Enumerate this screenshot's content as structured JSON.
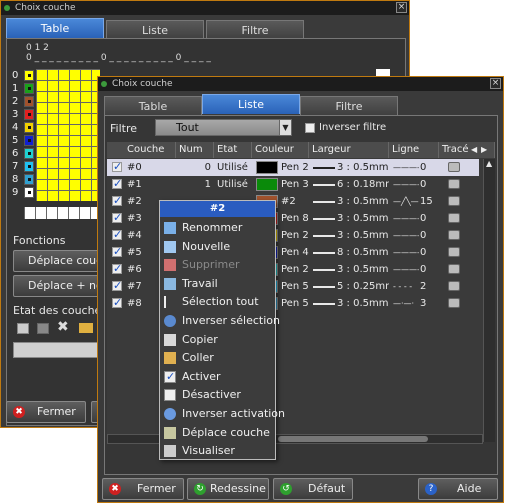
{
  "back_window": {
    "title": "Choix couche",
    "tabs": [
      "Table",
      "Liste",
      "Filtre"
    ],
    "active_tab": "Table",
    "ruler_top": "0                           1                           2",
    "ruler_bottom": "0 _ _ _ _ _ _ _ _ _ 0 _ _ _ _ _ _ _ _ _ 0 _ _ _ _",
    "row_numbers": [
      "0",
      "1",
      "2",
      "3",
      "4",
      "5",
      "6",
      "7",
      "8",
      "9"
    ],
    "row_colors": [
      "#ffff00",
      "#1aa01a",
      "#a0522d",
      "#e02020",
      "#f0d000",
      "#1020d0",
      "#20d0d0",
      "#20c0f0",
      "#30a0d0",
      "#ffffff"
    ],
    "functions_label": "Fonctions",
    "move_button": "Déplace couch",
    "move_new_button": "Déplace + nou",
    "layer_state_label": "Etat des couches",
    "close_button": "Fermer"
  },
  "front_window": {
    "title": "Choix couche",
    "tabs": [
      "Table",
      "Liste",
      "Filtre"
    ],
    "active_tab": "Liste",
    "filter_label": "Filtre",
    "filter_value": "Tout",
    "invert_filter_label": "Inverser filtre",
    "columns": [
      "Couche",
      "Num",
      "Etat",
      "Couleur",
      "Largeur",
      "Ligne",
      "Tracé"
    ],
    "rows": [
      {
        "name": "#0",
        "num": "0",
        "state": "Utilisé",
        "color": "#000000",
        "pen": "Pen 2",
        "width": "3 : 0.5mm",
        "line": "0",
        "line_style": "solid",
        "checked": true,
        "selected": true
      },
      {
        "name": "#1",
        "num": "1",
        "state": "Utilisé",
        "color": "#0a8a0a",
        "pen": "Pen 3",
        "width": "6 : 0.18mm",
        "line": "0",
        "line_style": "solid",
        "checked": true,
        "selected": false
      },
      {
        "name": "#2",
        "num": "",
        "state": "",
        "color": "#a0522d",
        "pen": "#2",
        "width": "3 : 0.5mm",
        "line": "15",
        "line_style": "zigzag",
        "checked": true,
        "selected": false
      },
      {
        "name": "#3",
        "num": "",
        "state": "",
        "color": "#e02020",
        "pen": "Pen 8",
        "width": "3 : 0.5mm",
        "line": "0",
        "line_style": "solid",
        "checked": true,
        "selected": false
      },
      {
        "name": "#4",
        "num": "",
        "state": "",
        "color": "#f0d000",
        "pen": "Pen 2",
        "width": "3 : 0.5mm",
        "line": "0",
        "line_style": "solid",
        "checked": true,
        "selected": false
      },
      {
        "name": "#5",
        "num": "",
        "state": "",
        "color": "#1020d0",
        "pen": "Pen 4",
        "width": "8 : 0.5mm",
        "line": "0",
        "line_style": "solid",
        "checked": true,
        "selected": false
      },
      {
        "name": "#6",
        "num": "",
        "state": "",
        "color": "#20d0d0",
        "pen": "Pen 2",
        "width": "3 : 0.5mm",
        "line": "0",
        "line_style": "solid",
        "checked": true,
        "selected": false
      },
      {
        "name": "#7",
        "num": "",
        "state": "",
        "color": "#20c0f0",
        "pen": "Pen 5",
        "width": "5 : 0.25mm",
        "line": "2",
        "line_style": "dashed",
        "checked": true,
        "selected": false
      },
      {
        "name": "#8",
        "num": "",
        "state": "",
        "color": "#30a0d0",
        "pen": "Pen 5",
        "width": "3 : 0.5mm",
        "line": "3",
        "line_style": "dashdot",
        "checked": true,
        "selected": false
      }
    ],
    "buttons": {
      "close": "Fermer",
      "redraw": "Redessine",
      "default": "Défaut",
      "help": "Aide"
    }
  },
  "context_menu": {
    "title": "#2",
    "items": [
      {
        "label": "Renommer",
        "icon": "rename-icon",
        "enabled": true
      },
      {
        "label": "Nouvelle",
        "icon": "new-layer-icon",
        "enabled": true
      },
      {
        "label": "Supprimer",
        "icon": "delete-icon",
        "enabled": false
      },
      {
        "label": "Travail",
        "icon": "work-icon",
        "enabled": true
      },
      {
        "label": "Sélection tout",
        "icon": "select-all-icon",
        "enabled": true
      },
      {
        "label": "Inverser sélection",
        "icon": "invert-selection-icon",
        "enabled": true
      },
      {
        "label": "Copier",
        "icon": "copy-icon",
        "enabled": true
      },
      {
        "label": "Coller",
        "icon": "paste-icon",
        "enabled": true
      },
      {
        "label": "Activer",
        "icon": "checkbox-checked-icon",
        "enabled": true
      },
      {
        "label": "Désactiver",
        "icon": "checkbox-empty-icon",
        "enabled": true
      },
      {
        "label": "Inverser activation",
        "icon": "invert-activation-icon",
        "enabled": true
      },
      {
        "label": "Déplace couche",
        "icon": "move-layer-icon",
        "enabled": true
      },
      {
        "label": "Visualiser",
        "icon": "view-icon",
        "enabled": true
      }
    ]
  }
}
